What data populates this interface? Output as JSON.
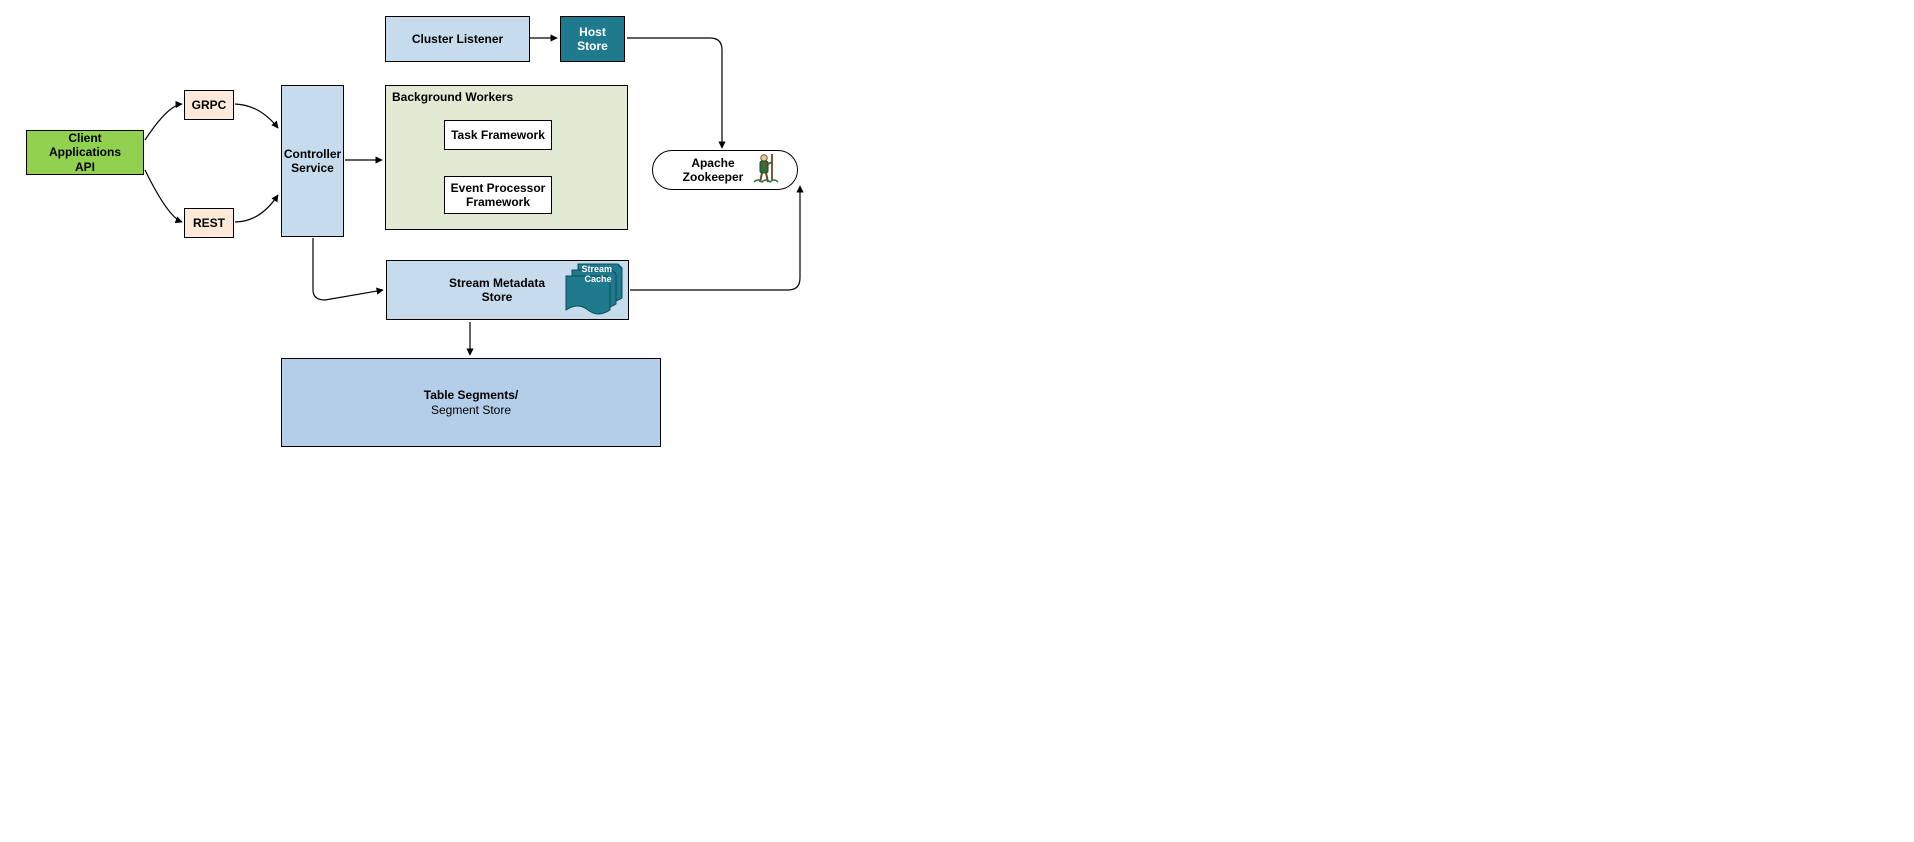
{
  "nodes": {
    "client_api": {
      "line1": "Client Applications",
      "line2": "API"
    },
    "grpc": "GRPC",
    "rest": "REST",
    "controller_service": {
      "line1": "Controller",
      "line2": "Service"
    },
    "cluster_listener": "Cluster Listener",
    "host_store": "Host Store",
    "background_workers_title": "Background Workers",
    "task_framework": "Task Framework",
    "event_processor_framework": {
      "line1": "Event Processor",
      "line2": "Framework"
    },
    "stream_metadata_store": {
      "line1": "Stream Metadata",
      "line2": "Store"
    },
    "stream_cache": {
      "line1": "Stream",
      "line2": "Cache"
    },
    "table_segments": {
      "line1": "Table Segments/",
      "line2": "Segment Store"
    },
    "zookeeper": {
      "line1": "Apache",
      "line2": "Zookeeper"
    }
  },
  "colors": {
    "green": "#92d050",
    "tan": "#fde9d9",
    "lightblue": "#c6dced",
    "olive": "#e3ead3",
    "white": "#ffffff",
    "teal": "#1e7a8c",
    "paleblue": "#bed7ee",
    "mediumblue": "#b4cde8",
    "border_dark": "#232323"
  }
}
